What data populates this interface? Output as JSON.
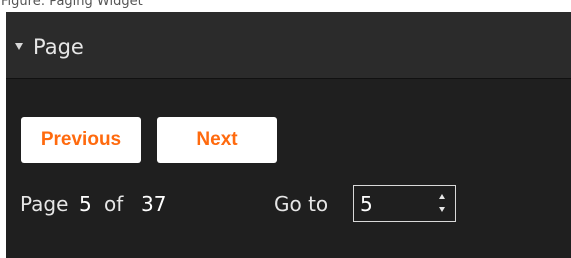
{
  "panel": {
    "title": "Page",
    "caption": "Figure: Paging Widget"
  },
  "navigation": {
    "previous_label": "Previous",
    "next_label": "Next"
  },
  "page_info": {
    "label": "Page",
    "current": "5",
    "of_label": "of",
    "total": "37"
  },
  "goto": {
    "label": "Go to",
    "value": "5"
  },
  "icons": {
    "collapse": "triangle-down-icon",
    "spin_up": "chevron-up-icon",
    "spin_down": "chevron-down-icon"
  },
  "colors": {
    "panel_background": "#1f1f1f",
    "header_background": "#2b2b2b",
    "button_background": "#ffffff",
    "button_text": "#ff6a0e",
    "text": "#e6e6e6"
  }
}
